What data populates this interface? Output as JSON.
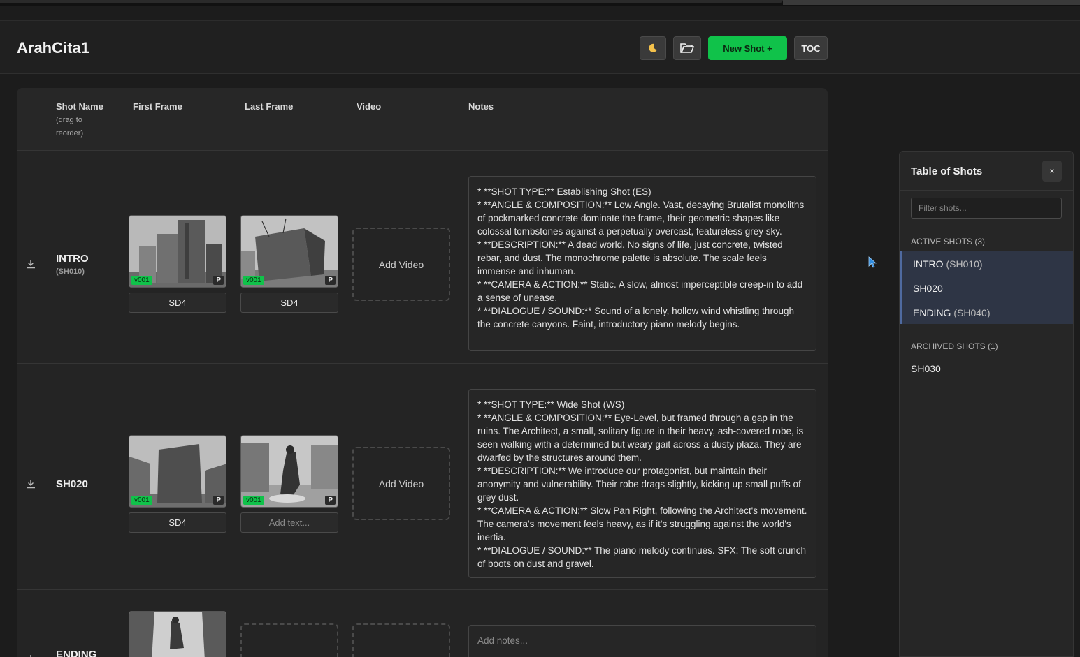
{
  "header": {
    "title": "ArahCita1",
    "new_shot_label": "New Shot +",
    "toc_label": "TOC",
    "theme_icon": "moon-icon",
    "folder_icon": "folder-open-icon",
    "accent_color": "#10c24a"
  },
  "table": {
    "columns": {
      "shot_name": "Shot Name",
      "shot_name_hint": "(drag to reorder)",
      "first_frame": "First Frame",
      "last_frame": "Last Frame",
      "video": "Video",
      "notes": "Notes"
    },
    "rows": [
      {
        "name": "INTRO",
        "code": "(SH010)",
        "first_frame": {
          "version": "v001",
          "badge": "P",
          "label": "SD4"
        },
        "last_frame": {
          "version": "v001",
          "badge": "P",
          "label": "SD4"
        },
        "video": "Add Video",
        "notes": [
          "*   **SHOT TYPE:** Establishing Shot (ES)",
          "*   **ANGLE & COMPOSITION:** Low Angle. Vast, decaying Brutalist monoliths of pockmarked concrete dominate the frame, their geometric shapes like colossal tombstones against a perpetually overcast, featureless grey sky.",
          "*   **DESCRIPTION:** A dead world. No signs of life, just concrete, twisted rebar, and dust. The monochrome palette is absolute. The scale feels immense and inhuman.",
          "*   **CAMERA & ACTION:** Static. A slow, almost imperceptible creep-in to add a sense of unease.",
          "*   **DIALOGUE / SOUND:** Sound of a lonely, hollow wind whistling through the concrete canyons. Faint, introductory piano melody begins."
        ]
      },
      {
        "name": "SH020",
        "code": "",
        "first_frame": {
          "version": "v001",
          "badge": "P",
          "label": "SD4"
        },
        "last_frame": {
          "version": "v001",
          "badge": "P",
          "label_placeholder": "Add text..."
        },
        "video": "Add Video",
        "notes": [
          "*   **SHOT TYPE:** Wide Shot (WS)",
          "*   **ANGLE & COMPOSITION:** Eye-Level, but framed through a gap in the ruins. The Architect, a small, solitary figure in their heavy, ash-covered robe, is seen walking with a determined but weary gait across a dusty plaza. They are dwarfed by the structures around them.",
          "*   **DESCRIPTION:** We introduce our protagonist, but maintain their anonymity and vulnerability. Their robe drags slightly, kicking up small puffs of grey dust.",
          "*   **CAMERA & ACTION:** Slow Pan Right, following the Architect's movement. The camera's movement feels heavy, as if it's struggling against the world's inertia.",
          "*   **DIALOGUE / SOUND:** The piano melody continues. SFX: The soft crunch of boots on dust and gravel."
        ]
      },
      {
        "name": "ENDING",
        "notes_placeholder": "Add notes..."
      }
    ]
  },
  "toc": {
    "title": "Table of Shots",
    "close_label": "×",
    "filter_placeholder": "Filter shots...",
    "active_heading": "ACTIVE SHOTS (3)",
    "active_items": [
      {
        "name": "INTRO",
        "code": "(SH010)"
      },
      {
        "name": "SH020",
        "code": ""
      },
      {
        "name": "ENDING",
        "code": "(SH040)"
      }
    ],
    "archived_heading": "ARCHIVED SHOTS (1)",
    "archived_items": [
      {
        "name": "SH030"
      }
    ]
  }
}
